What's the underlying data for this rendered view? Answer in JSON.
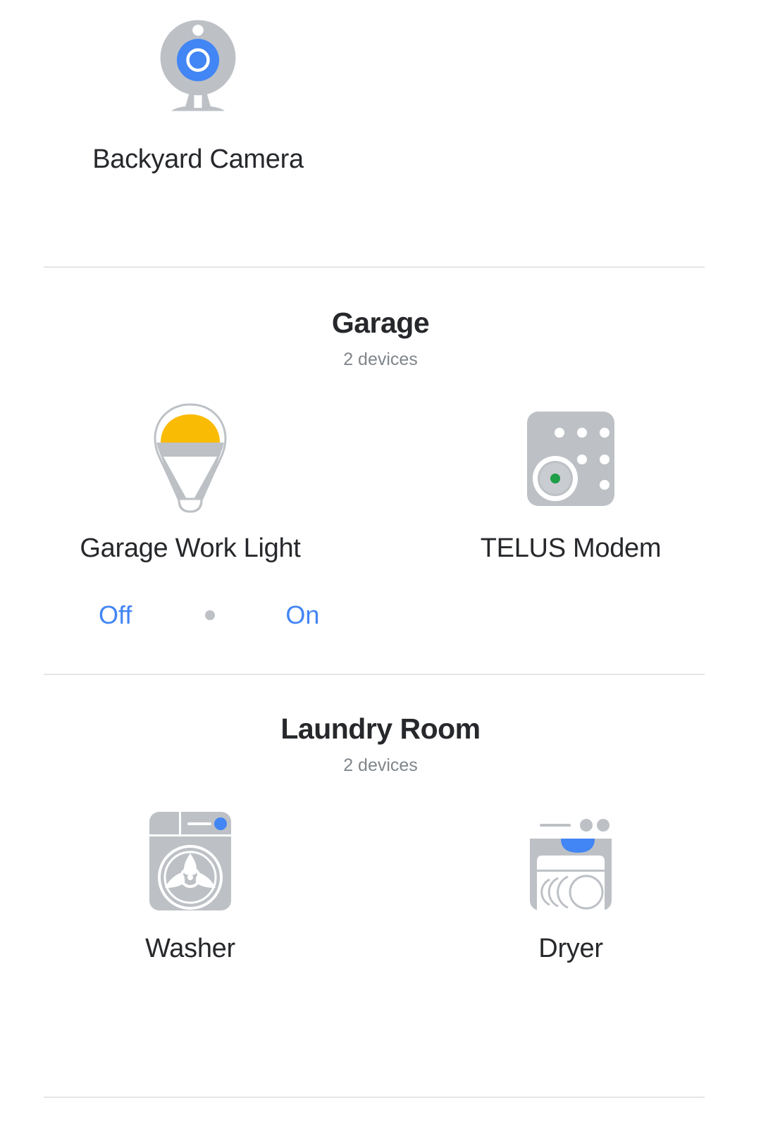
{
  "top_device": {
    "name": "Backyard Camera",
    "icon": "camera-icon"
  },
  "rooms": [
    {
      "title": "Garage",
      "device_count_label": "2 devices",
      "devices": [
        {
          "name": "Garage Work Light",
          "icon": "light-bulb-icon"
        },
        {
          "name": "TELUS Modem",
          "icon": "modem-icon"
        }
      ],
      "control": {
        "off_label": "Off",
        "on_label": "On"
      }
    },
    {
      "title": "Laundry Room",
      "device_count_label": "2 devices",
      "devices": [
        {
          "name": "Washer",
          "icon": "washer-icon"
        },
        {
          "name": "Dryer",
          "icon": "dryer-icon"
        }
      ]
    }
  ],
  "colors": {
    "accent_blue": "#4285f4",
    "bulb_amber": "#fabb05",
    "icon_gray": "#bdc1c6",
    "status_green": "#1e9e46",
    "text_primary": "#26282b",
    "text_secondary": "#80868b",
    "divider": "#e4e5e8"
  }
}
